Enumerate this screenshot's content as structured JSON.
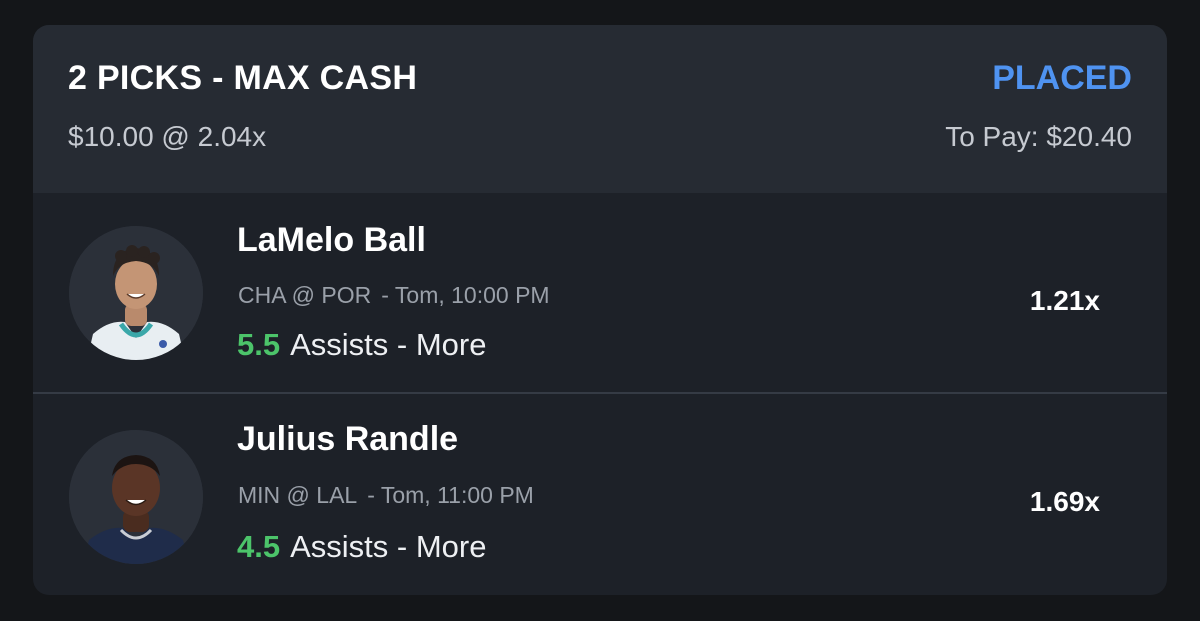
{
  "header": {
    "title": "2 PICKS - MAX CASH",
    "status": "PLACED",
    "stake": "$10.00 @ 2.04x",
    "to_pay": "To Pay: $20.40"
  },
  "picks": [
    {
      "player": "LaMelo Ball",
      "matchup": "CHA @ POR",
      "time": "- Tom, 10:00 PM",
      "line_value": "5.5",
      "stat": "Assists - More",
      "multiplier": "1.21x",
      "avatar_icon": "player-headshot-icon"
    },
    {
      "player": "Julius Randle",
      "matchup": "MIN @ LAL",
      "time": "- Tom, 11:00 PM",
      "line_value": "4.5",
      "stat": "Assists - More",
      "multiplier": "1.69x",
      "avatar_icon": "player-headshot-icon"
    }
  ],
  "colors": {
    "status_accent": "#4f93f1",
    "line_value": "#4cc46a"
  }
}
